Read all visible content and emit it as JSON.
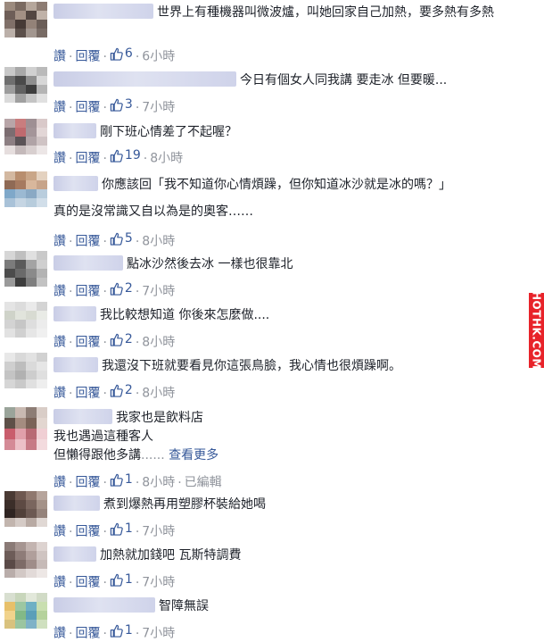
{
  "actions": {
    "like": "讚",
    "reply": "回覆",
    "sep": "·",
    "more": "查看更多",
    "ellipsis": "......",
    "edited": "已編輯"
  },
  "watermark": "HOTHK.COM",
  "colors": {
    "link": "#365899",
    "meta": "#90949c",
    "watermark": "#e8232a"
  },
  "comments": [
    {
      "text": "世界上有種機器叫微波爐，叫她回家自己加熱，要多熱有多熱",
      "likes": "6",
      "time": "6小時"
    },
    {
      "text": "今日有個女人同我講 要走冰 但要暖...",
      "likes": "3",
      "time": "7小時"
    },
    {
      "text": "剛下班心情差了不起喔？",
      "likes": "19",
      "time": "8小時"
    },
    {
      "text": "你應該回「我不知道你心情煩躁，但你知道冰沙就是冰的嗎？」",
      "text2": "真的是沒常識又自以為是的奧客……",
      "likes": "5",
      "time": "8小時"
    },
    {
      "text": "點冰沙然後去冰 一樣也很靠北",
      "likes": "2",
      "time": "7小時"
    },
    {
      "text": "我比較想知道 你後來怎麼做....",
      "likes": "2",
      "time": "8小時"
    },
    {
      "text": "我還沒下班就要看見你這張鳥臉，我心情也很煩躁啊。",
      "likes": "2",
      "time": "8小時"
    },
    {
      "text": "我家也是飲料店",
      "text2": "我也遇過這種客人",
      "text3": "但懶得跟他多講",
      "likes": "1",
      "time": "8小時"
    },
    {
      "text": "煮到爆熱再用塑膠杯裝給她喝",
      "likes": "1",
      "time": "7小時"
    },
    {
      "text": "加熱就加錢吧 瓦斯特調費",
      "likes": "1",
      "time": "7小時"
    },
    {
      "text": "智障無誤",
      "likes": "1",
      "time": "7小時"
    }
  ]
}
